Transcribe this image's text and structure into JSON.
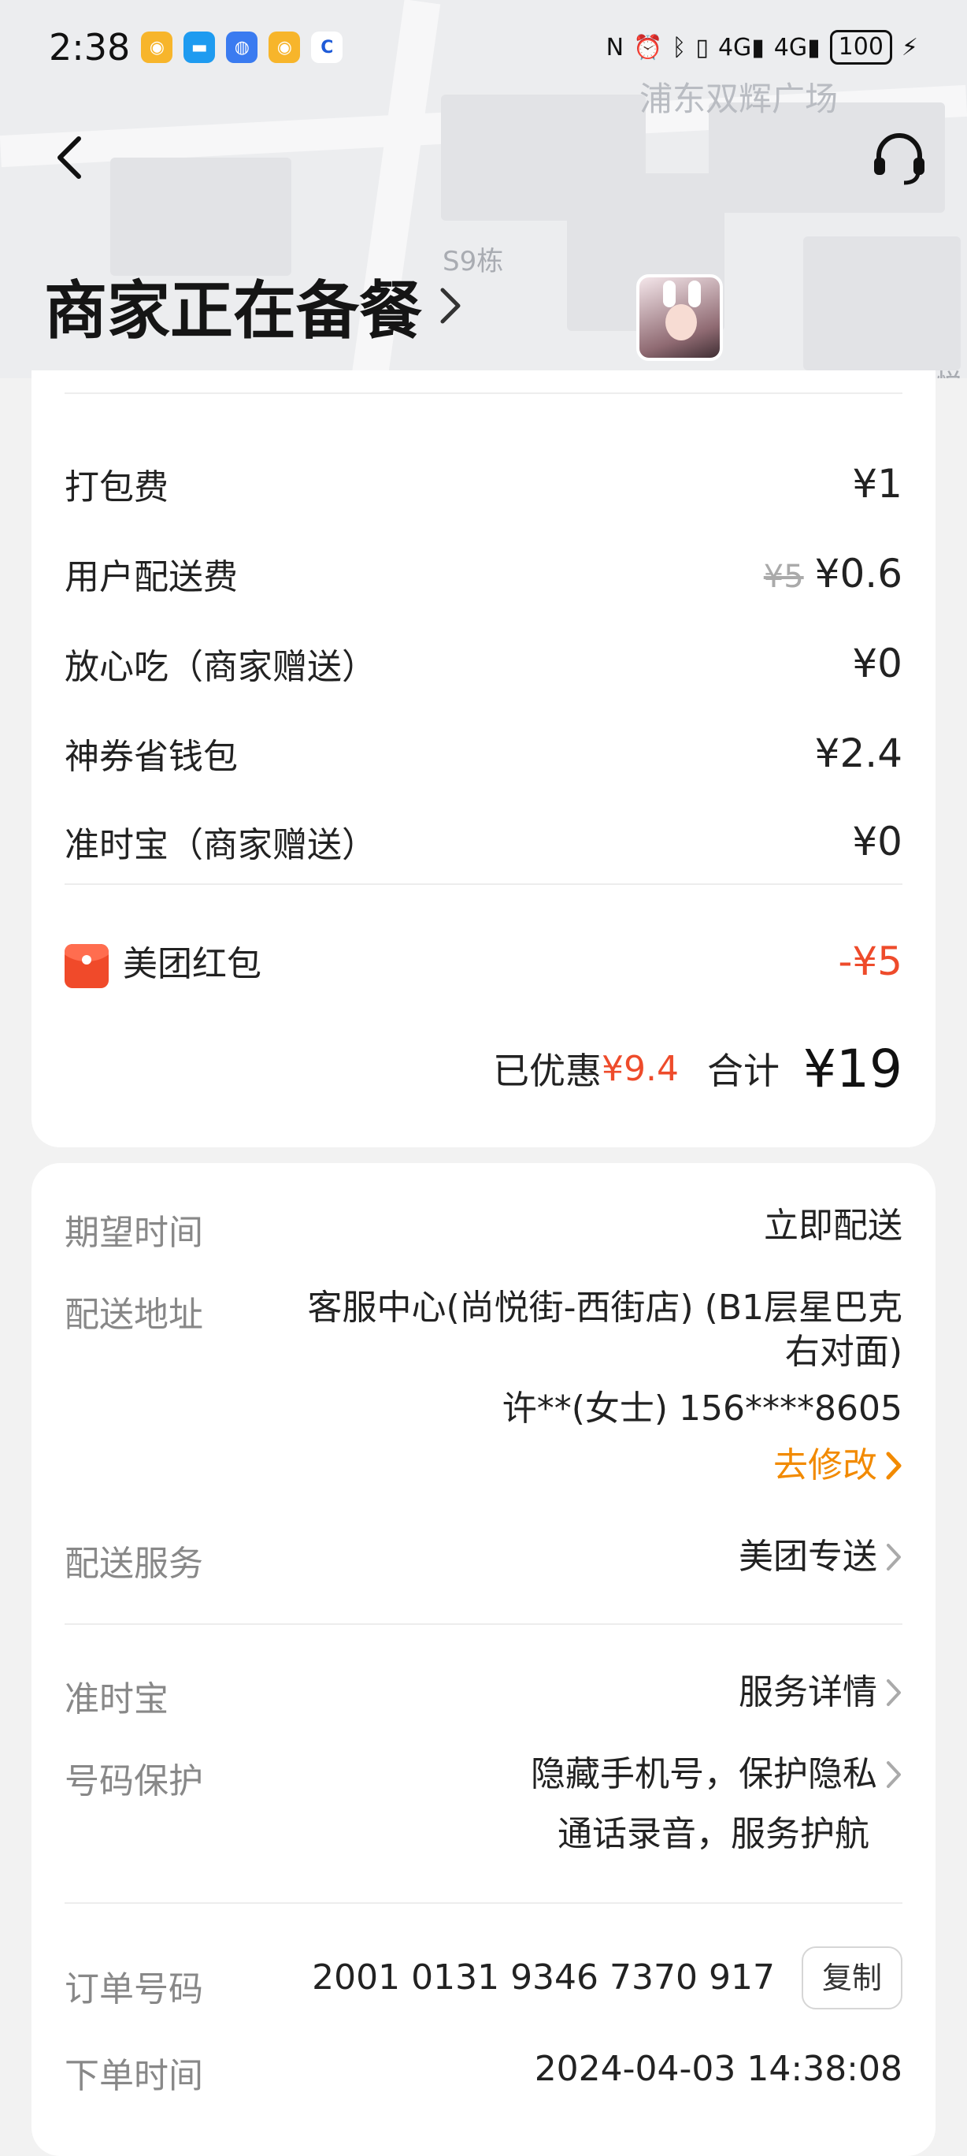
{
  "status_bar": {
    "time": "2:38",
    "app_icons": [
      "weibo-icon",
      "message-icon",
      "browser-icon",
      "weibo-icon",
      "bank-icon"
    ],
    "signal_1": "4G",
    "signal_2": "4G",
    "battery": "100"
  },
  "map": {
    "labels": [
      "浦东双辉广场",
      "S9栋",
      "悦"
    ]
  },
  "header": {
    "status_title": "商家正在备餐"
  },
  "fees": [
    {
      "label": "打包费",
      "value": "¥1"
    },
    {
      "label": "用户配送费",
      "original": "¥5",
      "value": "¥0.6"
    },
    {
      "label": "放心吃（商家赠送）",
      "value": "¥0"
    },
    {
      "label": "神券省钱包",
      "value": "¥2.4"
    },
    {
      "label": "准时宝（商家赠送）",
      "value": "¥0"
    }
  ],
  "red_packet": {
    "label": "美团红包",
    "value": "-¥5"
  },
  "summary": {
    "discount_label": "已优惠",
    "discount_value": "¥9.4",
    "total_label": "合计",
    "total_value": "¥19"
  },
  "delivery": {
    "expected_time": {
      "label": "期望时间",
      "value": "立即配送"
    },
    "address": {
      "label": "配送地址",
      "line1": "客服中心(尚悦街-西街店) (B1层星巴克",
      "line2": "右对面)",
      "contact": "许**(女士) 156****8605",
      "modify": "去修改"
    },
    "service": {
      "label": "配送服务",
      "value": "美团专送"
    },
    "ontime": {
      "label": "准时宝",
      "value": "服务详情"
    },
    "privacy": {
      "label": "号码保护",
      "line1": "隐藏手机号，保护隐私",
      "line2": "通话录音，服务护航"
    },
    "order_no": {
      "label": "订单号码",
      "value": "2001 0131 9346 7370 917",
      "copy": "复制"
    },
    "order_time": {
      "label": "下单时间",
      "value": "2024-04-03 14:38:08"
    }
  },
  "colors": {
    "accent_red": "#ee4b2b",
    "accent_orange": "#f28a00"
  }
}
